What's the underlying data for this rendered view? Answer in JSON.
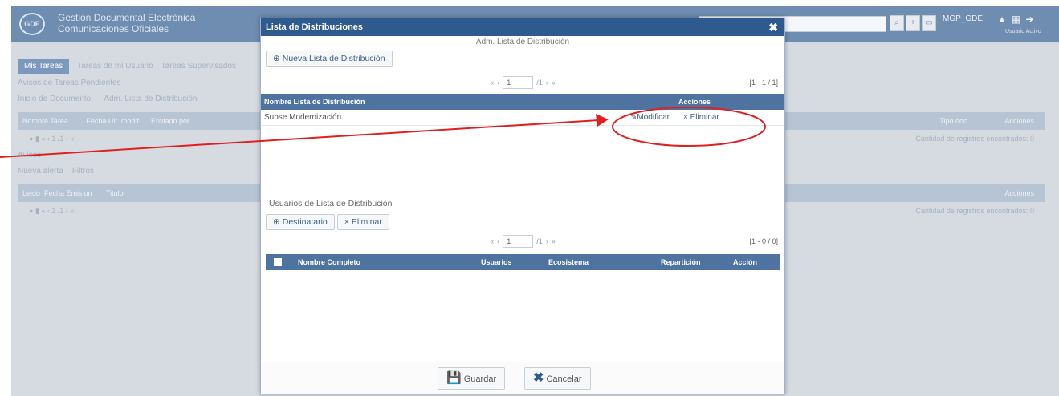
{
  "app": {
    "logo_text": "GDE",
    "title_line1": "Gestión Documental Electrónica",
    "title_line2": "Comunicaciones Oficiales",
    "user_name": "MGP_GDE",
    "user_sub": "Usuario Activo"
  },
  "background": {
    "tabs": [
      "Mis Tareas",
      "Tareas de mi Usuario",
      "Tareas Supervisados"
    ],
    "pending_label": "Avisos de Tareas Pendientes",
    "start_doc": "Inicio de Documento",
    "admin_list": "Adm. Lista de Distribución",
    "columns1": [
      "Nombre Tarea",
      "Fecha Ult. modif.",
      "Enviado por"
    ],
    "right_col1": "Tipo doc.",
    "right_col1b": "Acciones",
    "records_text": "Cantidad de registros encontrados: 0",
    "avisos_label": "Avisos",
    "new_alert": "Nueva alerta",
    "filters": "Filtros",
    "columns2": [
      "Leido",
      "Fecha Emision",
      "Titulo"
    ],
    "right_col2": "Acciones"
  },
  "modal": {
    "title": "Lista de Distribuciones",
    "subtitle": "Adm. Lista de Distribución",
    "new_list_button": "Nueva Lista de Distribución",
    "pager_top": {
      "first": "«",
      "prev": "‹",
      "page": "1",
      "of": "/1",
      "next": "›",
      "last": "»",
      "count": "[1 - 1 / 1]"
    },
    "lists_header": {
      "name": "Nombre Lista de Distribución",
      "actions": "Acciones"
    },
    "lists_rows": [
      {
        "name": "Subse Modernización",
        "modify": "Modificar",
        "delete": "Eliminar"
      }
    ],
    "users_legend": "Usuarios de Lista de Distribución",
    "recipient_button": "Destinatario",
    "delete_button": "Eliminar",
    "pager_bottom": {
      "first": "«",
      "prev": "‹",
      "page": "1",
      "of": "/1",
      "next": "›",
      "last": "»",
      "count": "[1 - 0 / 0]"
    },
    "users_header": {
      "name": "Nombre Completo",
      "user": "Usuarios",
      "ecosystem": "Ecosistema",
      "dept": "Repartición",
      "action": "Acción"
    },
    "save_button": "Guardar",
    "cancel_button": "Cancelar"
  },
  "colors": {
    "modal_header": "#2f5a90",
    "grid_header": "#4f73a1",
    "annotation": "#e02020"
  }
}
